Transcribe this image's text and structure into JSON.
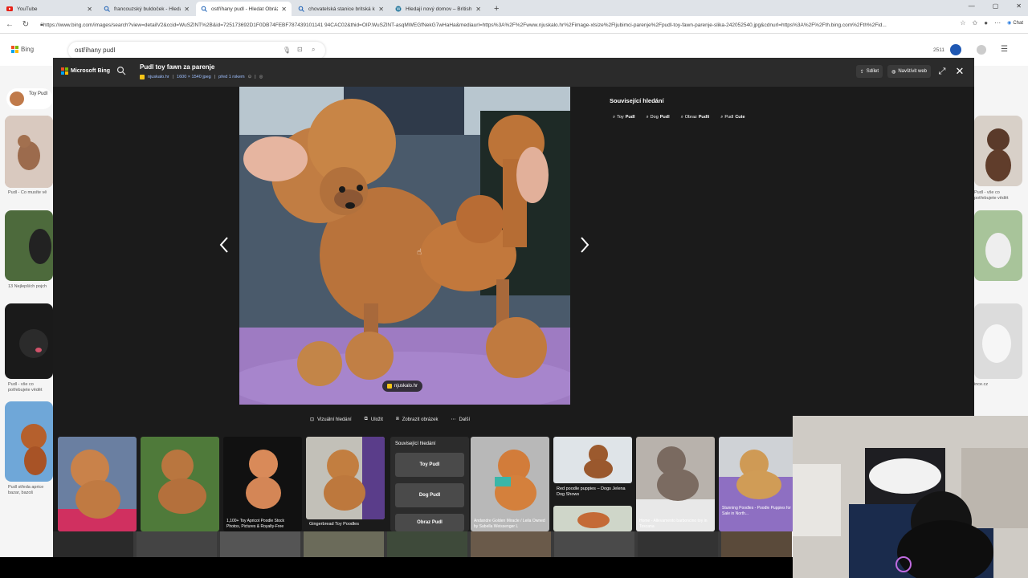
{
  "browser": {
    "tabs": [
      {
        "label": "YouTube",
        "icon": "youtube-icon",
        "active": false
      },
      {
        "label": "francouzský buldoček - Hledat",
        "icon": "search-icon",
        "active": false
      },
      {
        "label": "ostříhany pudl - Hledat Obrázky",
        "icon": "search-icon",
        "active": true
      },
      {
        "label": "chovatelská stanice britská kočka",
        "icon": "search-icon",
        "active": false
      },
      {
        "label": "Hledají nový domov – British Velvet",
        "icon": "wordpress-icon",
        "active": false
      }
    ],
    "new_tab": "+",
    "url": "https://www.bing.com/images/search?view=detailV2&ccid=WuSZlNT%2B&id=725173692D1F0DB74FEBF787439101141 94CAC02&thid=OIP.WuSZlNT-asqMWEGfNekG7wHaHa&mediaurl=https%3A%2F%2Fwww.njuskalo.hr%2Fimage-xlsize%2Fljubimci-parenje%2Fpudl-toy-fawn-parenje-slika-242052540.jpg&cdnurl=https%3A%2F%2Fth.bing.com%2Fth%2Fid...",
    "chat_label": "Chat"
  },
  "bing": {
    "logo": "Bing",
    "query": "ostříhany pudl",
    "rewards": "2511",
    "left_captions": [
      "Toy Pudl",
      "Pudl - Co musíte vě",
      "13 Nejlepších pojch",
      "Pudl - vše co potřebujete vědět",
      "Pudl středa aprice bazar, bazoš"
    ],
    "right_captions": [
      "Pudl - vše co potřebujete vědět",
      "ince.cz"
    ]
  },
  "overlay": {
    "brand": "Microsoft Bing",
    "title": "Pudl toy fawn za parenje",
    "meta": {
      "source": "njuskalo.hr",
      "size": "1600 × 1540 jpeg",
      "age": "před 1 rokem"
    },
    "actions": {
      "share": "Sdílet",
      "visit": "Navštívit web"
    },
    "image_source_pill": "njuskalo.hr",
    "related": {
      "title": "Související hledání",
      "chips": [
        {
          "light": "Toy",
          "bold": "Pudl"
        },
        {
          "light": "Dog",
          "bold": "Pudl"
        },
        {
          "light": "Obraz",
          "bold": "Pudli"
        },
        {
          "light": "Pudl",
          "bold": "Cute"
        }
      ]
    },
    "tools": [
      {
        "label": "Vizuální hledání",
        "icon": "visual-search-icon"
      },
      {
        "label": "Uložit",
        "icon": "save-icon"
      },
      {
        "label": "Zobrazit obrázek",
        "icon": "open-image-icon"
      },
      {
        "label": "Další",
        "icon": "more-icon"
      }
    ],
    "thumbs": [
      {
        "caption": ""
      },
      {
        "caption": ""
      },
      {
        "caption": "1,100+ Toy Apricot Poodle Stock Photos, Pictures & Royalty-Free"
      },
      {
        "caption": "Gingerbread Toy Poodles"
      },
      {
        "caption": "Andandre Golden Miracle / Leila Owned by Sabella Weissenger L"
      },
      {
        "caption": "Red poodle puppies – Dogs Jelena Dog Shows"
      },
      {
        "caption": "Home - Allevamento barboncino toy in Toscana"
      },
      {
        "caption": "Stunning Poodles - Poodle Puppies for Sale in North..."
      }
    ],
    "related_card": {
      "title": "Související hledání",
      "items": [
        "Toy Pudl",
        "Dog Pudl",
        "Obraz Pudl"
      ]
    }
  }
}
